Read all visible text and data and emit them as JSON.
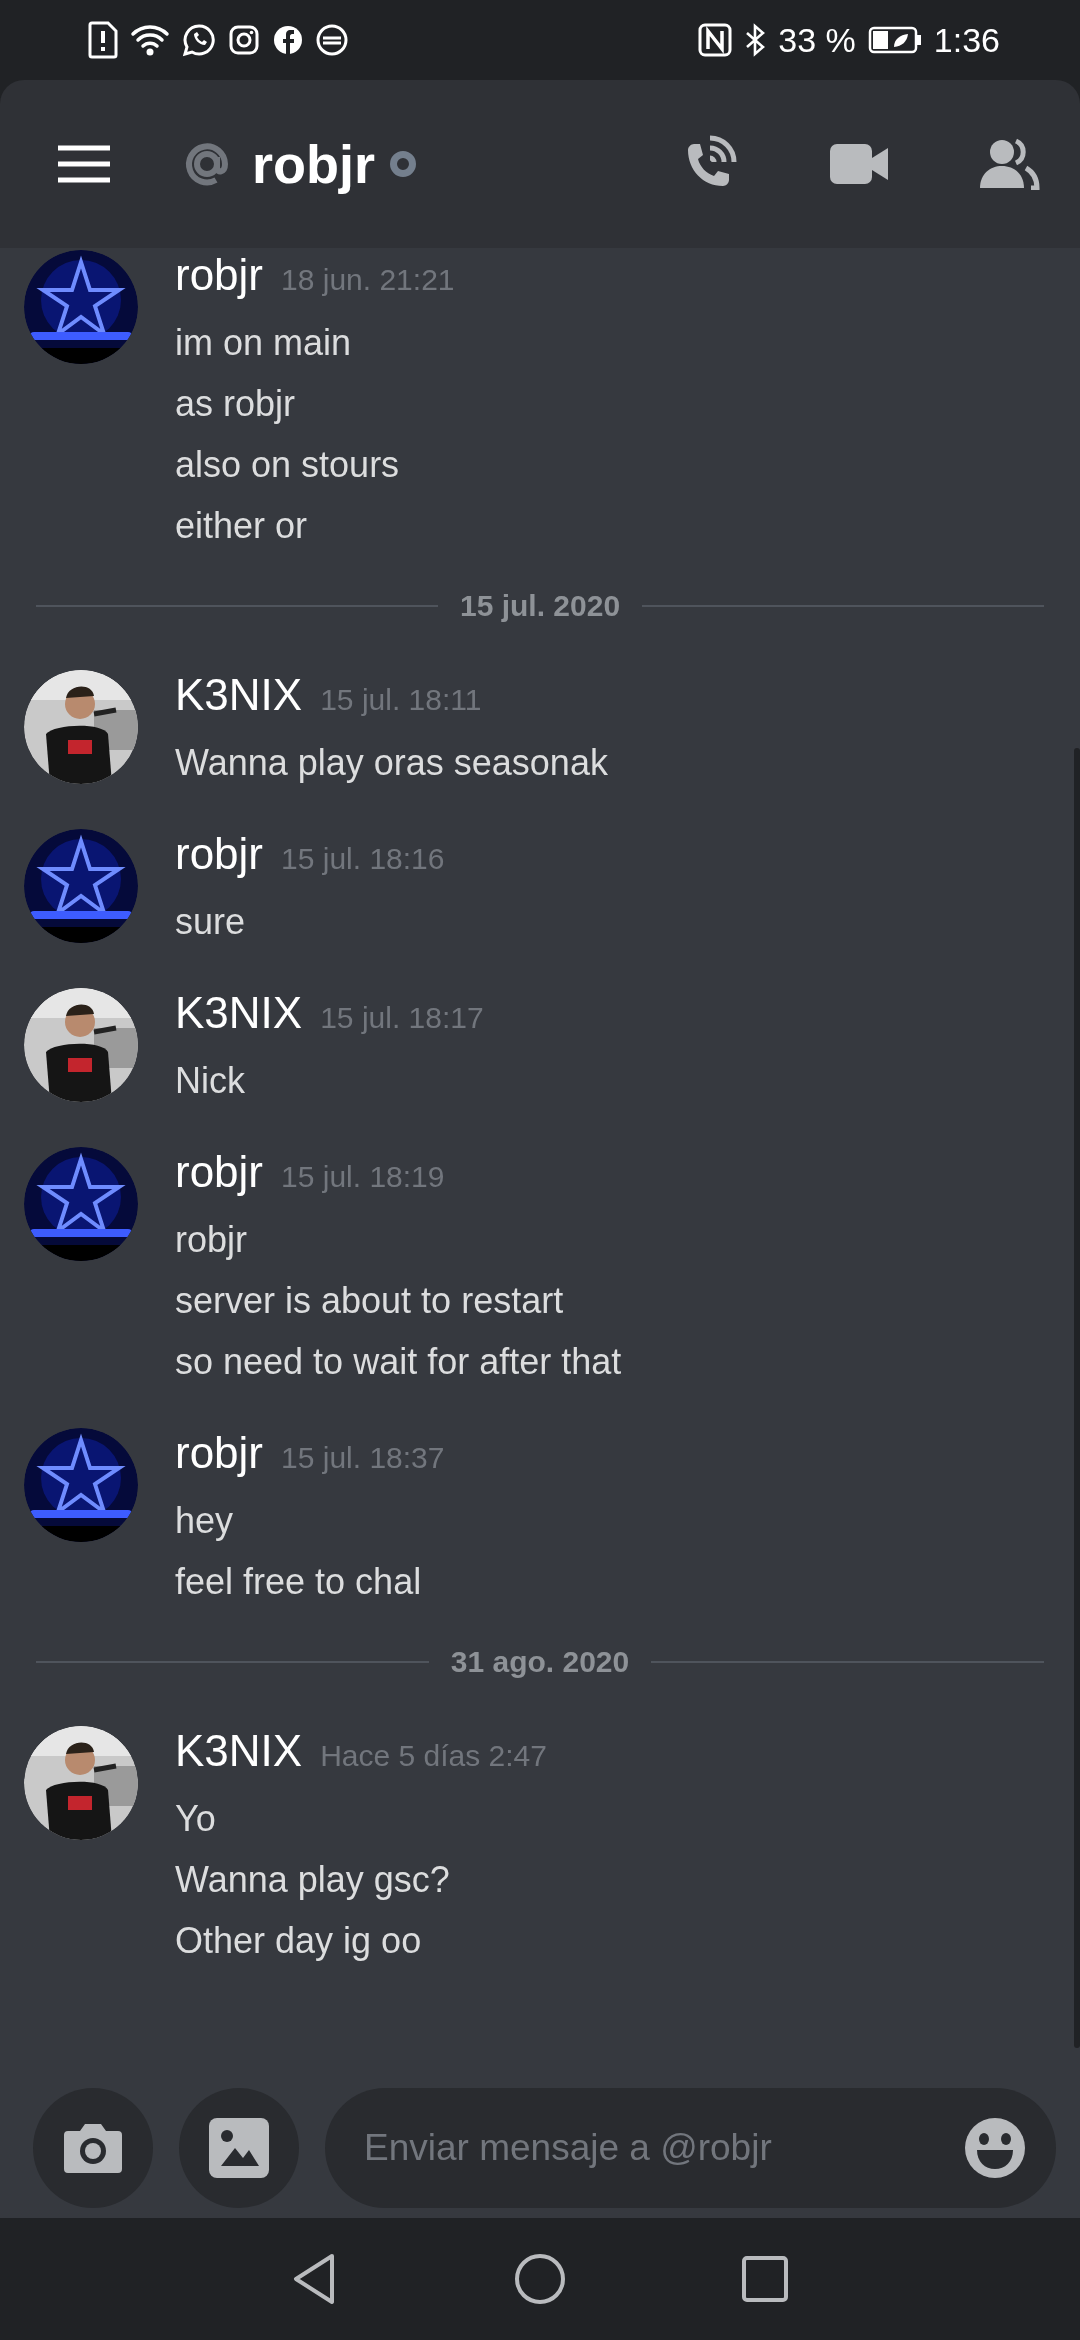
{
  "status_bar": {
    "battery": "33 %",
    "time": "1:36"
  },
  "header": {
    "title": "robjr"
  },
  "messages": [
    {
      "kind": "group",
      "author": "robjr",
      "avatar": {
        "kind": "star"
      },
      "timestamp": "18 jun. 21:21",
      "lines": [
        "im on main",
        "as robjr",
        "also on stours",
        "either or"
      ]
    },
    {
      "kind": "divider",
      "label": "15 jul. 2020"
    },
    {
      "kind": "group",
      "author": "K3NIX",
      "avatar": {
        "kind": "figure"
      },
      "timestamp": "15 jul. 18:11",
      "lines": [
        "Wanna play oras seasonak"
      ]
    },
    {
      "kind": "group",
      "author": "robjr",
      "avatar": {
        "kind": "star"
      },
      "timestamp": "15 jul. 18:16",
      "lines": [
        "sure"
      ]
    },
    {
      "kind": "group",
      "author": "K3NIX",
      "avatar": {
        "kind": "figure"
      },
      "timestamp": "15 jul. 18:17",
      "lines": [
        "Nick"
      ]
    },
    {
      "kind": "group",
      "author": "robjr",
      "avatar": {
        "kind": "star"
      },
      "timestamp": "15 jul. 18:19",
      "lines": [
        "robjr",
        "server is about to restart",
        "so need to wait for after that"
      ]
    },
    {
      "kind": "group",
      "author": "robjr",
      "avatar": {
        "kind": "star"
      },
      "timestamp": "15 jul. 18:37",
      "lines": [
        "hey",
        "feel free to chal"
      ]
    },
    {
      "kind": "divider",
      "label": "31 ago. 2020"
    },
    {
      "kind": "group",
      "author": "K3NIX",
      "avatar": {
        "kind": "figure"
      },
      "timestamp": "Hace 5 días 2:47",
      "lines": [
        "Yo",
        "Wanna play gsc?",
        "Other day ig oo"
      ]
    }
  ],
  "composer": {
    "placeholder": "Enviar mensaje a @robjr"
  }
}
